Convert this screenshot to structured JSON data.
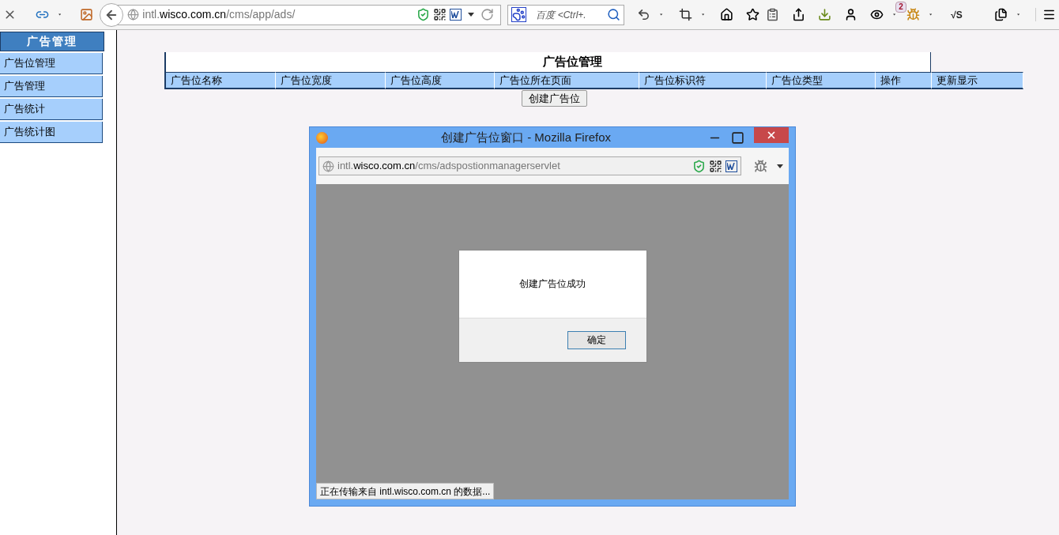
{
  "browser": {
    "url": "intl.**wisco.com.cn**/cms/app/ads/",
    "search": {
      "placeholder": "百度 <Ctrl+."
    },
    "badge": "2",
    "extension_label": "√S"
  },
  "sidebar": {
    "title": "广告管理",
    "items": [
      {
        "label": "广告位管理"
      },
      {
        "label": "广告管理"
      },
      {
        "label": "广告统计"
      },
      {
        "label": "广告统计图"
      }
    ]
  },
  "table": {
    "title": "广告位管理",
    "columns": [
      "广告位名称",
      "广告位宽度",
      "广告位高度",
      "广告位所在页面",
      "广告位标识符",
      "广告位类型",
      "操作",
      "更新显示"
    ]
  },
  "create_button": "创建广告位",
  "popup": {
    "title": "创建广告位窗口 - Mozilla Firefox",
    "url": "intl.**wisco.com.cn**/cms/adspostionmanagerservlet",
    "status": "正在传输来自 intl.wisco.com.cn 的数据...",
    "dialog": {
      "message": "创建广告位成功",
      "button": "确定"
    }
  }
}
